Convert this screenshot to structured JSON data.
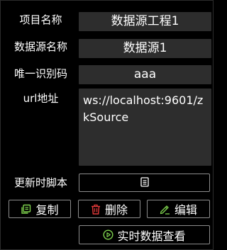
{
  "form": {
    "project_name_label": "项目名称",
    "project_name_value": "数据源工程1",
    "datasource_name_label": "数据源名称",
    "datasource_name_value": "数据源1",
    "unique_id_label": "唯一识别码",
    "unique_id_value": "aaa",
    "url_label": "url地址",
    "url_value": "ws://localhost:9601/zkSource",
    "script_label": "更新时脚本"
  },
  "actions": {
    "copy_label": "复制",
    "delete_label": "删除",
    "edit_label": "编辑",
    "realtime_label": "实时数据查看"
  },
  "icons": {
    "script": "document-icon",
    "copy": "copy-icon",
    "delete": "trash-icon",
    "edit": "pencil-icon",
    "realtime": "play-circle-icon"
  },
  "colors": {
    "background": "#000000",
    "field_background": "#2d2d2d",
    "border": "#8c8c8c",
    "copy_accent": "#7fd34e",
    "delete_accent": "#e53a3a",
    "edit_accent": "#7fd34e",
    "realtime_accent": "#7fd34e"
  }
}
